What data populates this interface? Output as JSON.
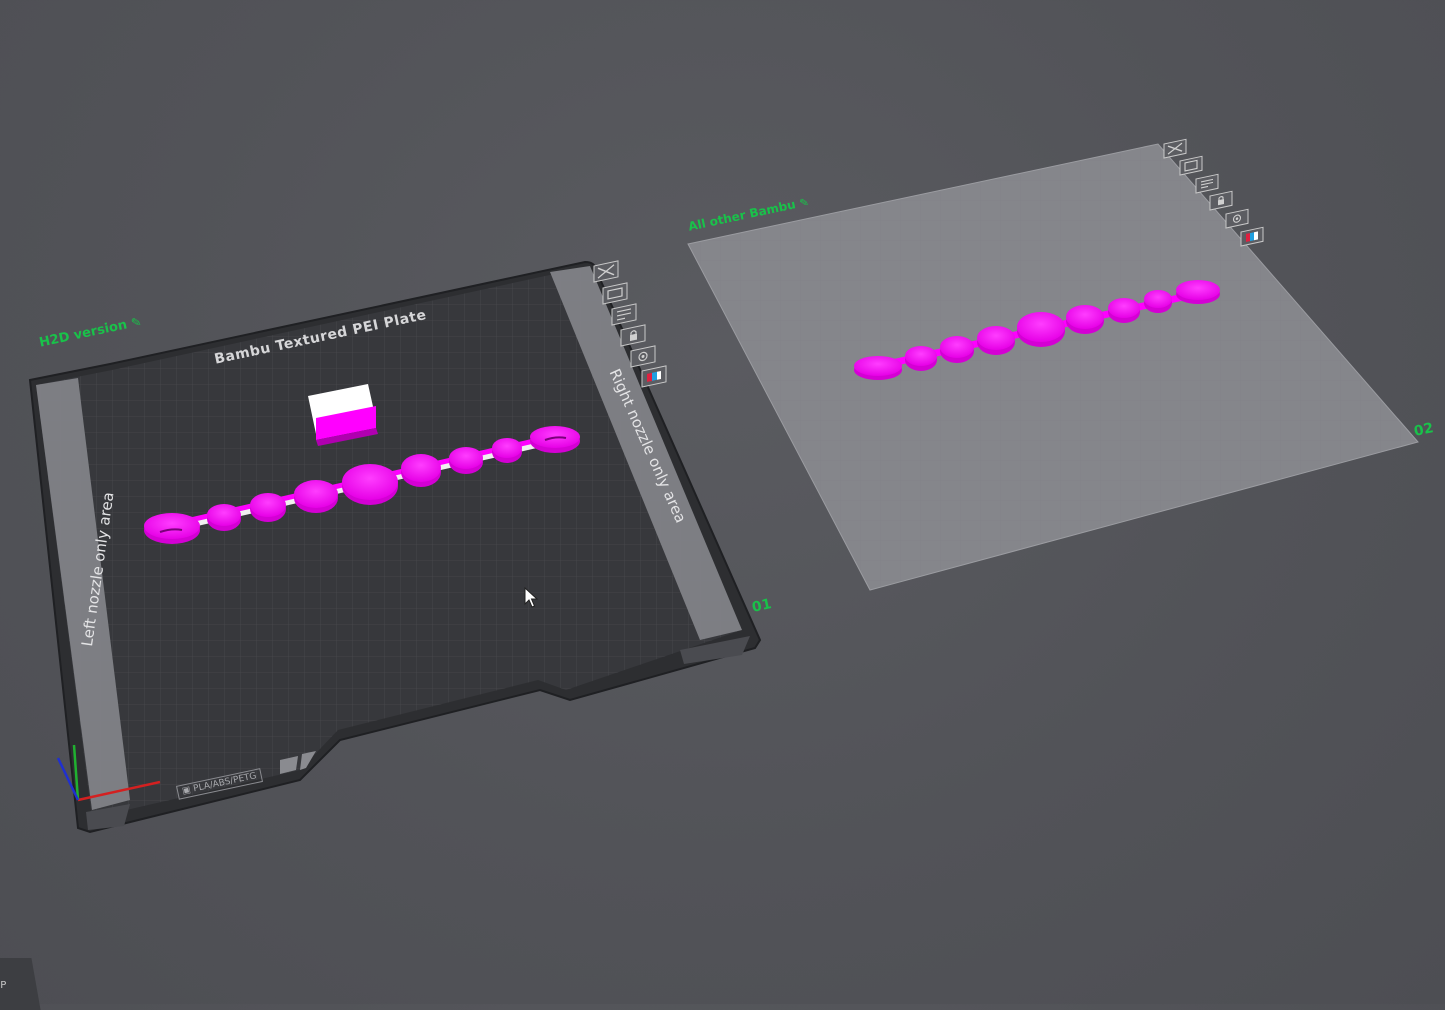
{
  "plates": [
    {
      "name": "H2D version",
      "number": "01",
      "texture": "Bambu Textured PEI Plate",
      "left_zone": "Left nozzle only area",
      "right_zone": "Right nozzle only area",
      "filament_tag": "PLA/ABS/PETG",
      "toolbar": [
        "close-icon",
        "arrange-icon",
        "orient-icon",
        "lock-icon",
        "settings-icon",
        "filament-icon"
      ]
    },
    {
      "name": "All other Bambu",
      "number": "02",
      "toolbar": [
        "close-icon",
        "arrange-icon",
        "orient-icon",
        "lock-icon",
        "settings-icon",
        "filament-icon"
      ]
    }
  ],
  "model_color": "#ff00ff",
  "accent_color": "#19c24a",
  "corner_tab": "P"
}
